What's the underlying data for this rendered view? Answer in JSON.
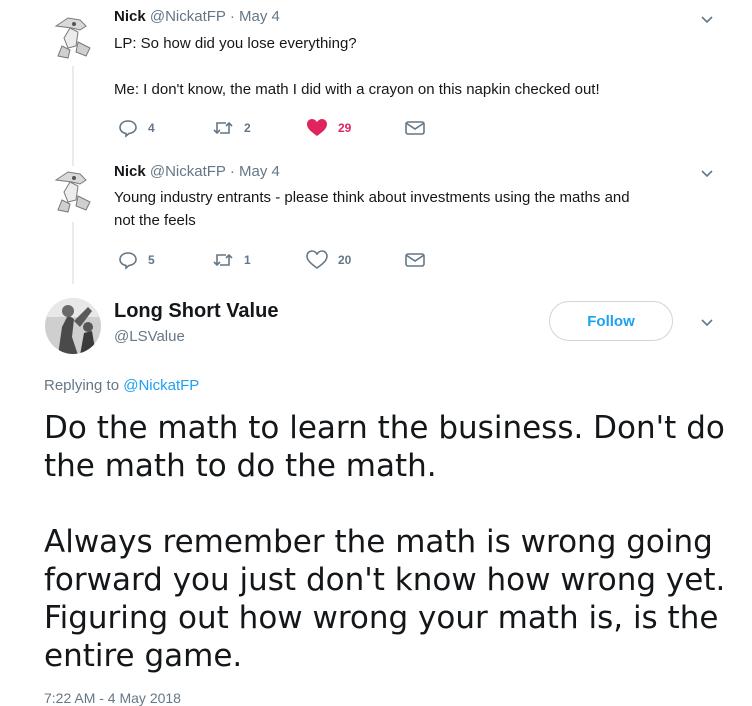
{
  "tweets": [
    {
      "name": "Nick",
      "handle": "@NickatFP",
      "separator": "·",
      "date": "May 4",
      "text": "LP: So how did you lose everything?\n\nMe: I don't know, the math I did with a crayon on this napkin checked out!",
      "replies": "4",
      "retweets": "2",
      "likes": "29",
      "liked": true
    },
    {
      "name": "Nick",
      "handle": "@NickatFP",
      "separator": "·",
      "date": "May 4",
      "text": "Young industry entrants - please think about investments using the maths and\nnot the feels",
      "replies": "5",
      "retweets": "1",
      "likes": "20",
      "liked": false
    }
  ],
  "main_tweet": {
    "name": "Long Short Value",
    "handle": "@LSValue",
    "follow_label": "Follow",
    "replying_prefix": "Replying to",
    "replying_to": "@NickatFP",
    "text": "Do the math to learn the business.  Don't do the math to do the math.\n\nAlways remember the math is wrong going forward you just don't know how wrong yet. Figuring out how wrong your math is, is the entire game.",
    "timestamp": "7:22 AM - 4 May 2018"
  },
  "colors": {
    "accent": "#1da1f2",
    "like": "#e0245e",
    "muted": "#657786",
    "text": "#14171a"
  },
  "icons": [
    "reply-icon",
    "retweet-icon",
    "heart-icon",
    "message-icon",
    "chevron-down-icon"
  ]
}
